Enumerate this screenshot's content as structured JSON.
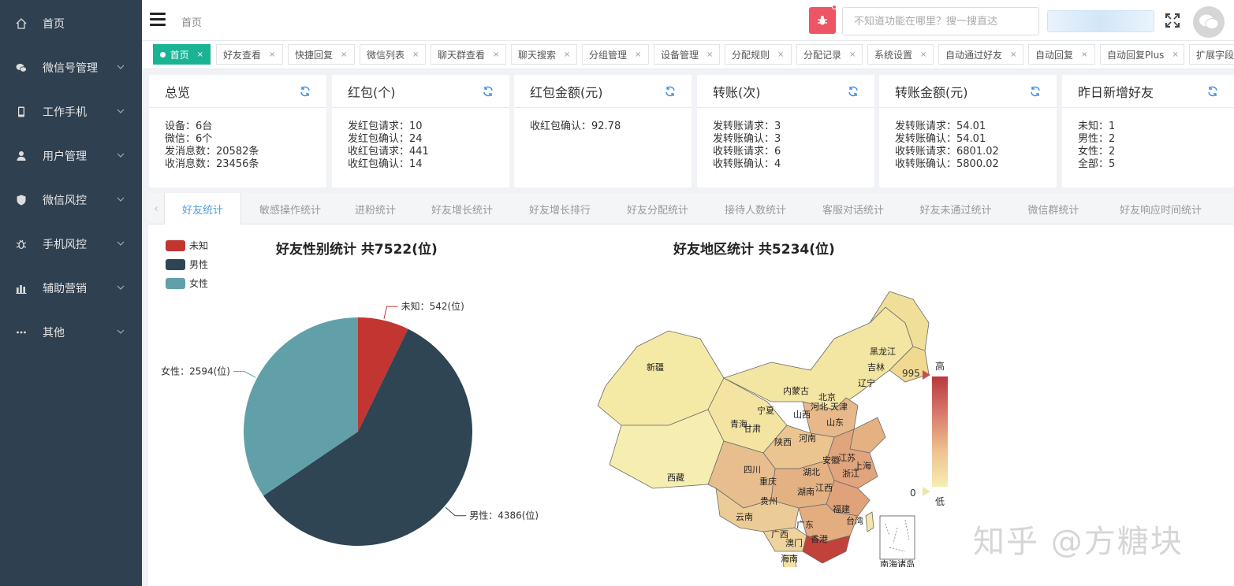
{
  "sidebar": {
    "items": [
      {
        "label": "首页",
        "icon": "home-icon",
        "has_arrow": false
      },
      {
        "label": "微信号管理",
        "icon": "wechat-icon",
        "has_arrow": true
      },
      {
        "label": "工作手机",
        "icon": "mobile-icon",
        "has_arrow": true
      },
      {
        "label": "用户管理",
        "icon": "user-icon",
        "has_arrow": true
      },
      {
        "label": "微信风控",
        "icon": "shield-icon",
        "has_arrow": true
      },
      {
        "label": "手机风控",
        "icon": "bug-icon",
        "has_arrow": true
      },
      {
        "label": "辅助营销",
        "icon": "bar-chart-icon",
        "has_arrow": true
      },
      {
        "label": "其他",
        "icon": "more-icon",
        "has_arrow": true
      }
    ]
  },
  "header": {
    "breadcrumb": "首页",
    "search_placeholder": "不知道功能在哪里？搜一搜直达",
    "bug_color": "#ed5565"
  },
  "page_tabs": [
    {
      "label": "首页",
      "active": true
    },
    {
      "label": "好友查看"
    },
    {
      "label": "快捷回复"
    },
    {
      "label": "微信列表"
    },
    {
      "label": "聊天群查看"
    },
    {
      "label": "聊天搜索"
    },
    {
      "label": "分组管理"
    },
    {
      "label": "设备管理"
    },
    {
      "label": "分配规则"
    },
    {
      "label": "分配记录"
    },
    {
      "label": "系统设置"
    },
    {
      "label": "自动通过好友"
    },
    {
      "label": "自动回复"
    },
    {
      "label": "自动回复Plus"
    },
    {
      "label": "扩展字段"
    }
  ],
  "cards": [
    {
      "title": "总览",
      "lines": [
        "设备：6台",
        "微信：6个",
        "发消息数：20582条",
        "收消息数：23456条"
      ]
    },
    {
      "title": "红包(个)",
      "lines": [
        "发红包请求：10",
        "发红包确认：24",
        "收红包请求：441",
        "收红包确认：14"
      ]
    },
    {
      "title": "红包金额(元)",
      "lines": [
        "收红包确认：92.78"
      ]
    },
    {
      "title": "转账(次)",
      "lines": [
        "发转账请求：3",
        "发转账确认：3",
        "收转账请求：6",
        "收转账确认：4"
      ]
    },
    {
      "title": "转账金额(元)",
      "lines": [
        "发转账请求：54.01",
        "发转账确认：54.01",
        "收转账请求：6801.02",
        "收转账确认：5800.02"
      ]
    },
    {
      "title": "昨日新增好友",
      "lines": [
        "未知：1",
        "男性：2",
        "女性：2",
        "全部：5"
      ]
    }
  ],
  "stats_tabs": [
    {
      "label": "好友统计",
      "active": true
    },
    {
      "label": "敏感操作统计"
    },
    {
      "label": "进粉统计"
    },
    {
      "label": "好友增长统计"
    },
    {
      "label": "好友增长排行"
    },
    {
      "label": "好友分配统计"
    },
    {
      "label": "接待人数统计"
    },
    {
      "label": "客服对话统计"
    },
    {
      "label": "好友未通过统计"
    },
    {
      "label": "微信群统计"
    },
    {
      "label": "好友响应时间统计"
    }
  ],
  "chart_data": [
    {
      "type": "pie",
      "title": "好友性别统计 共7522(位)",
      "legend": "top-left",
      "series": [
        {
          "name": "未知",
          "value": 542,
          "label": "未知：542(位)",
          "color": "#c23531"
        },
        {
          "name": "男性",
          "value": 4386,
          "label": "男性：4386(位)",
          "color": "#2f4554"
        },
        {
          "name": "女性",
          "value": 2594,
          "label": "女性：2594(位)",
          "color": "#61a0a8"
        }
      ]
    },
    {
      "type": "map",
      "title": "好友地区统计 共5234(位)",
      "visual_map": {
        "min": 0,
        "max": 995,
        "high_label": "高",
        "low_label": "低",
        "min_label": "0",
        "max_label": "995"
      },
      "region_labels": [
        "黑龙江",
        "吉林",
        "辽宁",
        "内蒙古",
        "北京",
        "天津",
        "河北",
        "山西",
        "山东",
        "宁夏",
        "甘肃",
        "青海",
        "新疆",
        "西藏",
        "陕西",
        "河南",
        "江苏",
        "安徽",
        "上海",
        "湖北",
        "浙江",
        "四川",
        "重庆",
        "湖南",
        "江西",
        "贵州",
        "福建",
        "云南",
        "广东",
        "广西",
        "台湾",
        "香港",
        "澳门",
        "海南",
        "南海诸岛"
      ]
    }
  ],
  "watermark": "知乎 @方糖块"
}
